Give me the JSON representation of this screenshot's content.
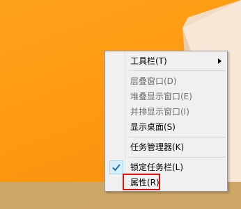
{
  "context_menu": {
    "items": [
      {
        "label": "工具栏(T)",
        "enabled": true,
        "has_submenu": true
      },
      {
        "label": "层叠窗口(D)",
        "enabled": false
      },
      {
        "label": "堆叠显示窗口(E)",
        "enabled": false
      },
      {
        "label": "并排显示窗口(I)",
        "enabled": false
      },
      {
        "label": "显示桌面(S)",
        "enabled": true
      },
      {
        "label": "任务管理器(K)",
        "enabled": true
      },
      {
        "label": "锁定任务栏(L)",
        "enabled": true,
        "checked": true
      },
      {
        "label": "属性(R)",
        "enabled": true,
        "highlighted": true
      }
    ]
  },
  "colors": {
    "wallpaper": "#ff9a12",
    "highlight_outline": "#e01010",
    "check_blue": "#1e72a8"
  }
}
